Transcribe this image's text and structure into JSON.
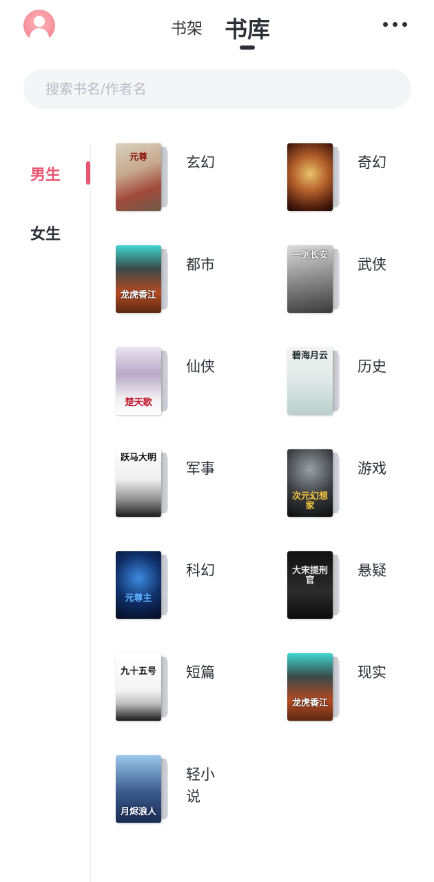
{
  "header": {
    "tabs": [
      {
        "label": "书架",
        "active": false
      },
      {
        "label": "书库",
        "active": true
      }
    ],
    "avatar_icon": "user-avatar-icon",
    "more_icon": "more-dots-icon"
  },
  "search": {
    "placeholder": "搜索书名/作者名",
    "value": ""
  },
  "sidebar": {
    "items": [
      {
        "label": "男生",
        "active": true
      },
      {
        "label": "女生",
        "active": false
      }
    ]
  },
  "categories": [
    {
      "label": "玄幻",
      "cover_title": "元尊"
    },
    {
      "label": "奇幻",
      "cover_title": ""
    },
    {
      "label": "都市",
      "cover_title": "龙虎香江"
    },
    {
      "label": "武侠",
      "cover_title": "一剑长安"
    },
    {
      "label": "仙侠",
      "cover_title": "楚天歌"
    },
    {
      "label": "历史",
      "cover_title": "碧海月云"
    },
    {
      "label": "军事",
      "cover_title": "跃马大明"
    },
    {
      "label": "游戏",
      "cover_title": "次元幻想家"
    },
    {
      "label": "科幻",
      "cover_title": "元尊主"
    },
    {
      "label": "悬疑",
      "cover_title": "大宋提刑官"
    },
    {
      "label": "短篇",
      "cover_title": "九十五号"
    },
    {
      "label": "现实",
      "cover_title": "龙虎香江"
    },
    {
      "label": "轻小说",
      "cover_title": "月烬浪人"
    }
  ],
  "colors": {
    "accent": "#e8546f",
    "text": "#2b2f36",
    "search_bg": "#f4f5f7"
  }
}
